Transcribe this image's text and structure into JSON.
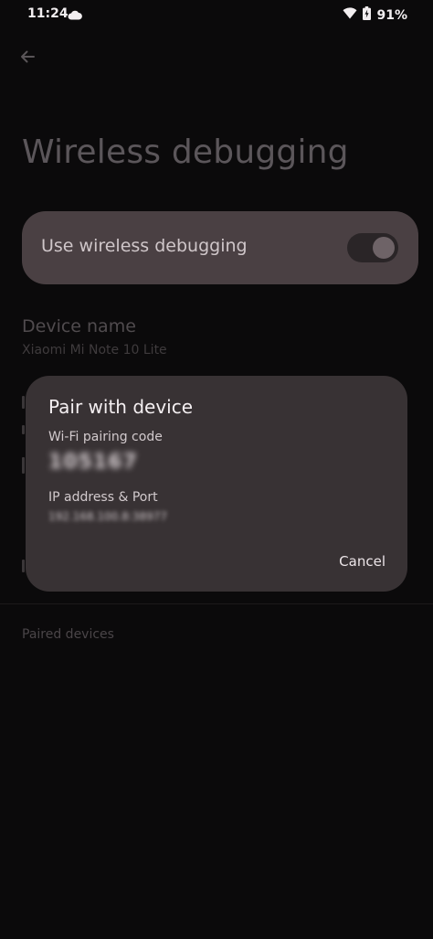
{
  "status_bar": {
    "time": "11:24",
    "battery_text": "91%",
    "icons": [
      "cloud-icon",
      "wifi-icon",
      "battery-icon"
    ]
  },
  "header": {
    "back_icon": "arrow-back-icon",
    "title": "Wireless debugging"
  },
  "main_toggle": {
    "label": "Use wireless debugging",
    "state": "on"
  },
  "device_name": {
    "title": "Device name",
    "value": "Xiaomi Mi Note 10 Lite"
  },
  "paired_devices": {
    "header": "Paired devices"
  },
  "dialog": {
    "title": "Pair with device",
    "pairing_code_label": "Wi-Fi pairing code",
    "pairing_code_value": "105167",
    "ip_port_label": "IP address & Port",
    "ip_port_value": "192.168.100.8:38977",
    "cancel_label": "Cancel"
  },
  "colors": {
    "background": "#0b0a0b",
    "card": "#4a4043",
    "dialog": "#383234"
  }
}
